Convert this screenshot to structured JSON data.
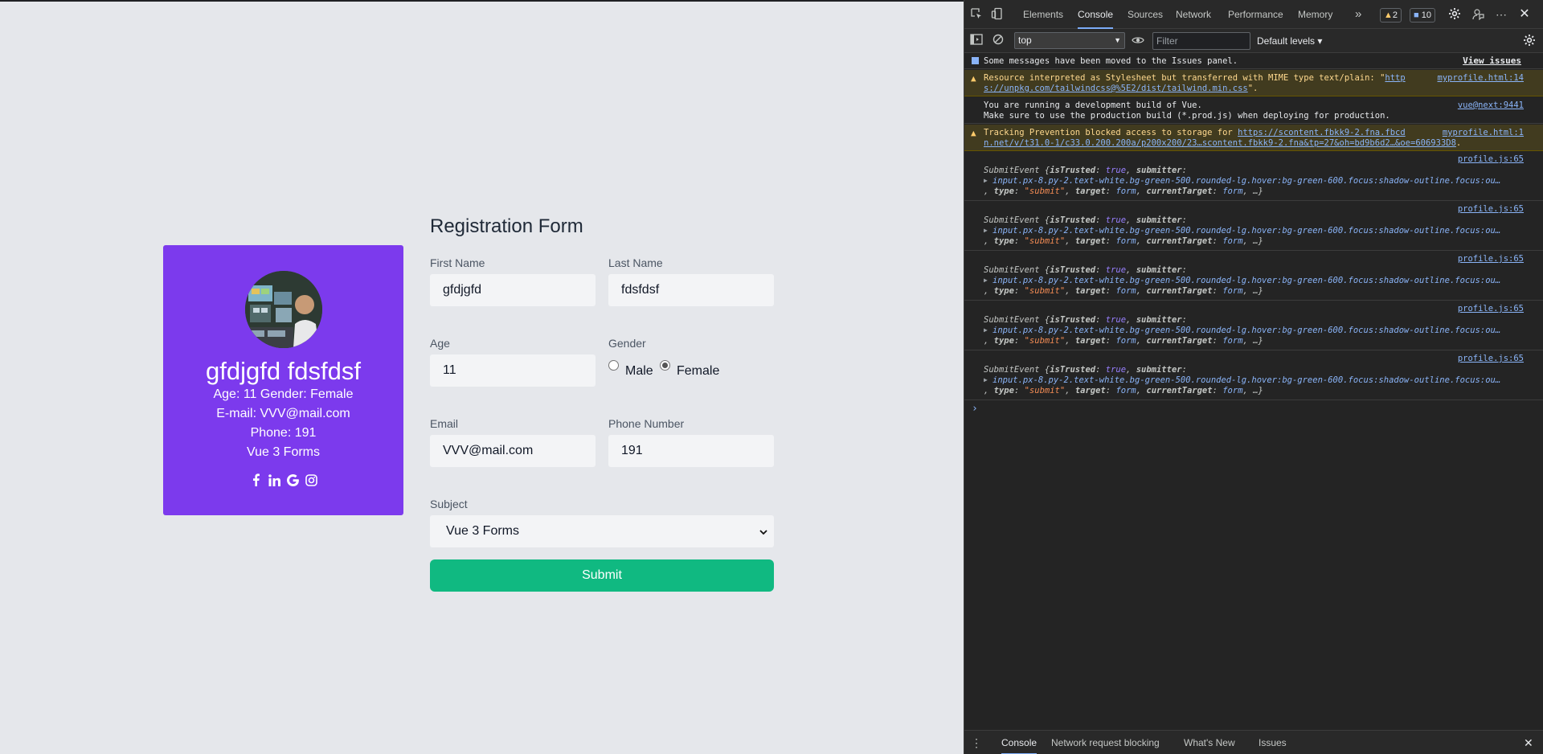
{
  "profile": {
    "name": "gfdjgfd fdsfdsf",
    "age_gender": "Age: 11 Gender: Female",
    "email": "E-mail: VVV@mail.com",
    "phone": "Phone: 191",
    "subject": "Vue 3 Forms",
    "social_icons": [
      "facebook-icon",
      "linkedin-icon",
      "google-icon",
      "instagram-icon"
    ],
    "card_color": "#7c3aed"
  },
  "form": {
    "title": "Registration Form",
    "first_name_label": "First Name",
    "first_name_value": "gfdjgfd",
    "last_name_label": "Last Name",
    "last_name_value": "fdsfdsf",
    "age_label": "Age",
    "age_value": "11",
    "gender_label": "Gender",
    "gender_male": "Male",
    "gender_female": "Female",
    "gender_selected": "Female",
    "email_label": "Email",
    "email_value": "VVV@mail.com",
    "phone_label": "Phone Number",
    "phone_value": "191",
    "subject_label": "Subject",
    "subject_value": "Vue 3 Forms",
    "submit_label": "Submit",
    "submit_color": "#10b981"
  },
  "devtools": {
    "tabs": [
      "Elements",
      "Console",
      "Sources",
      "Network",
      "Performance",
      "Memory"
    ],
    "active_tab": "Console",
    "more_tabs": "»",
    "warnings_count": "2",
    "messages_count": "10",
    "context": "top",
    "filter_placeholder": "Filter",
    "levels": "Default levels ▾",
    "console": {
      "issues_msg": "Some messages have been moved to the Issues panel.",
      "view_issues": "View issues",
      "warn1_a": "Resource interpreted as Stylesheet but transferred with MIME type text/plain: \"",
      "warn1_link": "http",
      "warn1_link2": "s://unpkg.com/tailwindcss@%5E2/dist/tailwind.min.css",
      "warn1_end": "\".",
      "warn1_src": "myprofile.html:14",
      "vue1": "You are running a development build of Vue.",
      "vue2": "Make sure to use the production build (*.prod.js) when deploying for production.",
      "vue_src": "vue@next:9441",
      "warn2_a": "Tracking Prevention blocked access to storage for ",
      "warn2_link": "https://scontent.fbkk9-2.fna.fbcd",
      "warn2_link2": "n.net/v/t31.0-1/c33.0.200.200a/p200x200/23…scontent.fbkk9-2.fna&tp=27&oh=bd9b6d2…&oe=606933D8",
      "warn2_end": ".",
      "warn2_src": "myprofile.html:1",
      "submit_src": "profile.js:65",
      "submit_line1_a": "SubmitEvent {",
      "submit_line1_k1": "isTrusted",
      "submit_line1_v1": "true",
      "submit_line1_k2": "submitter",
      "submit_line2": "input.px-8.py-2.text-white.bg-green-500.rounded-lg.hover:bg-green-600.focus:shadow-outline.focus:ou…",
      "submit_line3_k1": "type",
      "submit_line3_v1": "\"submit\"",
      "submit_line3_k2": "target",
      "submit_line3_v2": "form",
      "submit_line3_k3": "currentTarget",
      "submit_line3_v3": "form",
      "submit_line3_end": "…}",
      "prompt": "›"
    },
    "bottom_tabs": [
      "Console",
      "Network request blocking",
      "What's New",
      "Issues"
    ],
    "bottom_active": "Console",
    "bottom_menu": "⋮"
  }
}
